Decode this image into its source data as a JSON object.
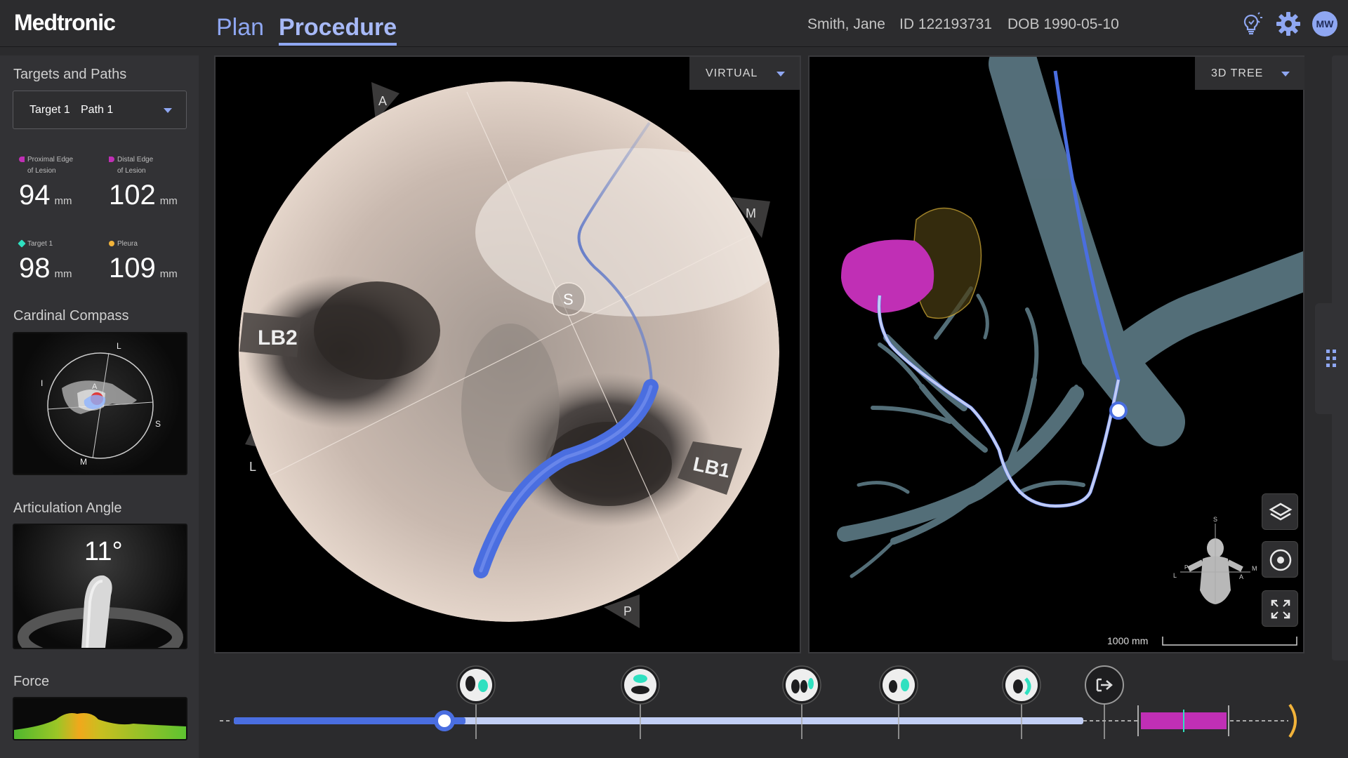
{
  "header": {
    "brand": "Medtronic",
    "tabs": [
      {
        "label": "Plan",
        "active": false
      },
      {
        "label": "Procedure",
        "active": true
      }
    ],
    "patient": {
      "name": "Smith, Jane",
      "id": "ID 122193731",
      "dob": "DOB 1990-05-10"
    },
    "user_initials": "MW",
    "icons": [
      "lightbulb-icon",
      "gear-icon"
    ]
  },
  "sidebar": {
    "targets_title": "Targets and Paths",
    "target_select": {
      "target": "Target 1",
      "path": "Path 1"
    },
    "metrics": [
      {
        "label_line1": "Proximal Edge",
        "label_line2": "of Lesion",
        "value": "94",
        "unit": "mm",
        "color": "#c02fb5"
      },
      {
        "label_line1": "Distal Edge",
        "label_line2": "of Lesion",
        "value": "102",
        "unit": "mm",
        "color": "#c02fb5"
      },
      {
        "label_line1": "Target 1",
        "label_line2": "",
        "value": "98",
        "unit": "mm",
        "color": "#2fe0c0"
      },
      {
        "label_line1": "Pleura",
        "label_line2": "",
        "value": "109",
        "unit": "mm",
        "color": "#f2b33a"
      }
    ],
    "compass_title": "Cardinal Compass",
    "compass_labels": {
      "top": "L",
      "left": "I",
      "right": "S",
      "bottom": "M",
      "center": "A"
    },
    "articulation_title": "Articulation Angle",
    "articulation_value": "11°",
    "force_title": "Force"
  },
  "virtual_view": {
    "mode": "VIRTUAL",
    "center_marker": "S",
    "orientation_tabs": [
      "A",
      "M",
      "L",
      "P"
    ],
    "airway_labels": [
      "LB2",
      "LB1"
    ]
  },
  "tree_view": {
    "mode": "3D TREE",
    "scale_label": "1000 mm",
    "mannequin_labels": {
      "top": "S",
      "left": "L",
      "right": "M",
      "front": "A",
      "back": "P"
    },
    "buttons": [
      "layers-icon",
      "target-icon",
      "fullscreen-icon"
    ]
  },
  "timeline": {
    "progress_fraction": 0.19,
    "waypoints": 6
  },
  "colors": {
    "accent": "#8fa7f2",
    "path_blue": "#4a6ee0",
    "lesion_magenta": "#c02fb5",
    "target_cyan": "#2fe0c0",
    "pleura_yellow": "#f2b33a"
  }
}
